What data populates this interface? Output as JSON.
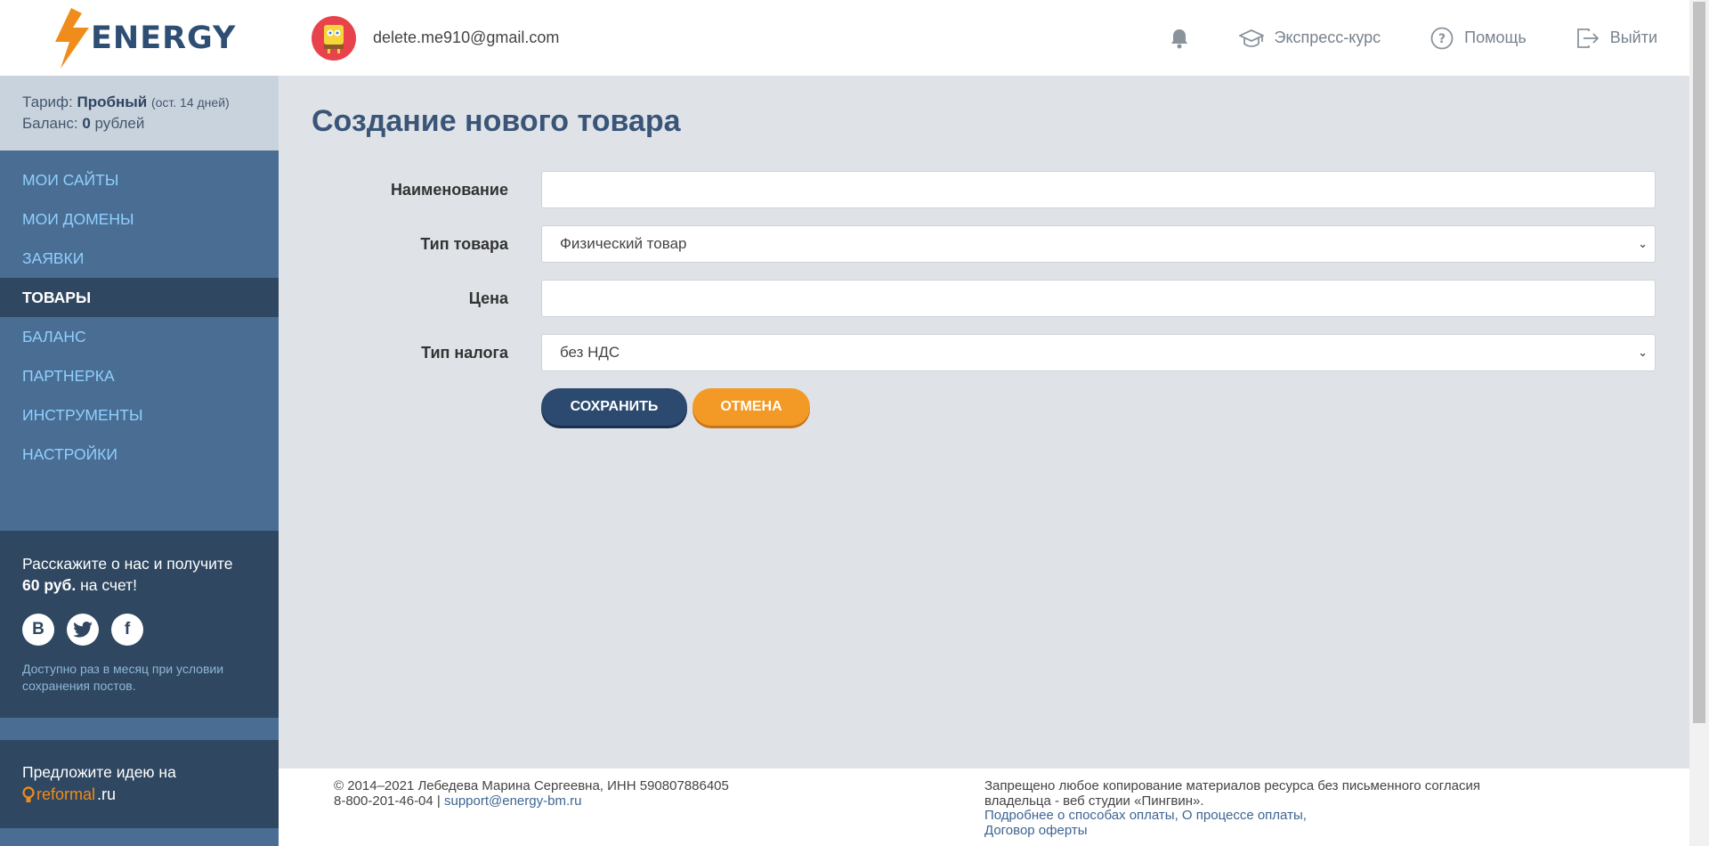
{
  "brand": {
    "name": "ENERGY",
    "accent": "#f08c1c",
    "primary": "#2f4e73"
  },
  "tariff": {
    "label": "Тариф:",
    "name": "Пробный",
    "remaining": "(ост. 14 дней)",
    "balance_label": "Баланс:",
    "balance_value": "0",
    "balance_unit": "рублей"
  },
  "menu": [
    {
      "label": "МОИ САЙТЫ",
      "active": false
    },
    {
      "label": "МОИ ДОМЕНЫ",
      "active": false
    },
    {
      "label": "ЗАЯВКИ",
      "active": false
    },
    {
      "label": "ТОВАРЫ",
      "active": true
    },
    {
      "label": "БАЛАНС",
      "active": false
    },
    {
      "label": "ПАРТНЕРКА",
      "active": false
    },
    {
      "label": "ИНСТРУМЕНТЫ",
      "active": false
    },
    {
      "label": "НАСТРОЙКИ",
      "active": false
    }
  ],
  "promo": {
    "line1": "Расскажите о нас и получите",
    "amount": "60 руб.",
    "line2": "на счет!",
    "socials": [
      "vk-icon",
      "twitter-icon",
      "facebook-icon"
    ],
    "note": "Доступно раз в месяц при условии сохранения постов."
  },
  "idea": {
    "text": "Предложите идею на",
    "brand_part1": "reformal",
    "brand_part2": ".ru"
  },
  "header": {
    "email": "delete.me910@gmail.com",
    "course": "Экспресс-курс",
    "help": "Помощь",
    "logout": "Выйти"
  },
  "page": {
    "title": "Создание нового товара"
  },
  "form": {
    "name_label": "Наименование",
    "name_value": "",
    "type_label": "Тип товара",
    "type_value": "Физический товар",
    "price_label": "Цена",
    "price_value": "",
    "tax_label": "Тип налога",
    "tax_value": "без НДС",
    "save": "СОХРАНИТЬ",
    "cancel": "ОТМЕНА"
  },
  "footer": {
    "copyright": "© 2014–2021 Лебедева Марина Сергеевна, ИНН 590807886405",
    "phone": "8-800-201-46-04 |",
    "support": "support@energy-bm.ru",
    "notice": "Запрещено любое копирование материалов ресурса без письменного согласия владельца - веб студии «Пингвин».",
    "link1": "Подробнее о способах оплаты,",
    "link2": "О процессе оплаты,",
    "link3": "Договор оферты"
  }
}
